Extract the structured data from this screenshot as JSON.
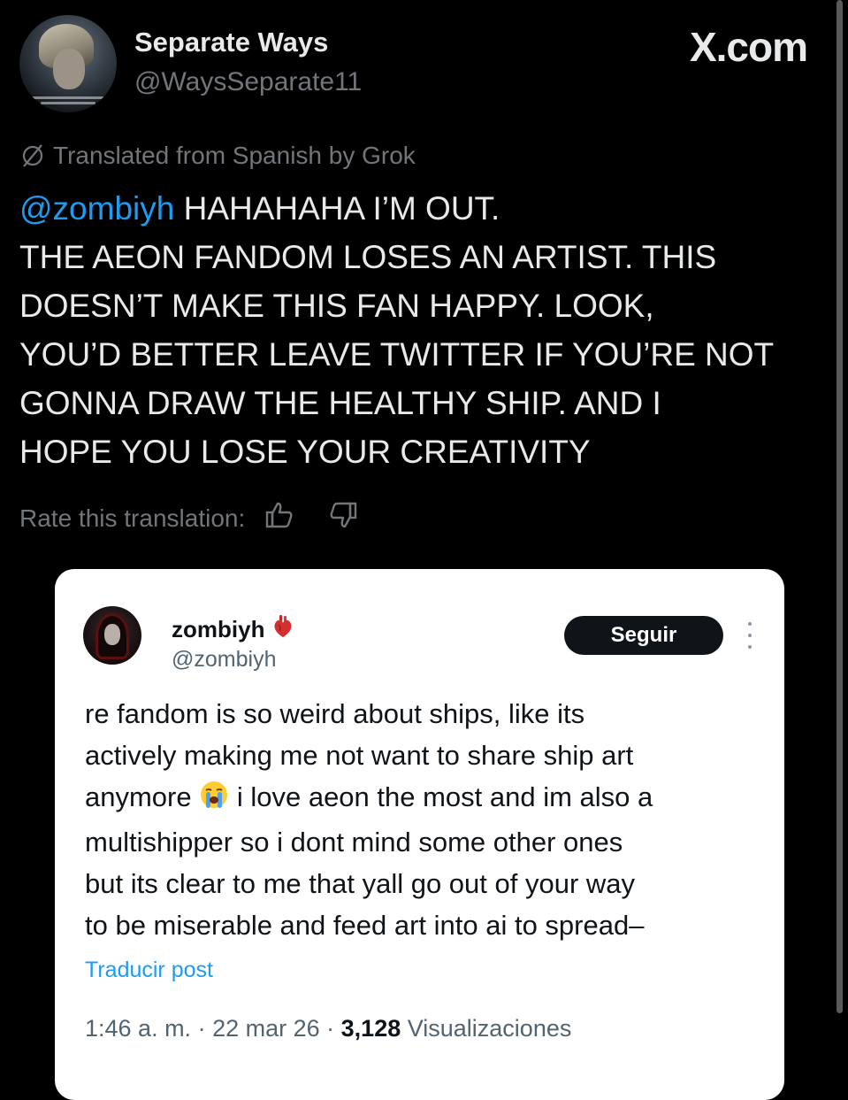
{
  "header": {
    "display_name": "Separate Ways",
    "handle": "@WaysSeparate11",
    "site_logo": "X.com",
    "avatar_icon": "profile-avatar"
  },
  "translation": {
    "notice": "Translated from Spanish by Grok",
    "icon": "translate-icon"
  },
  "tweet": {
    "mention": "@zombiyh",
    "body_first": " HAHAHAHA I’M OUT.",
    "body_rest": "THE AEON FANDOM LOSES AN ARTIST. THIS\nDOESN’T MAKE THIS FAN HAPPY. LOOK,\nYOU’D BETTER LEAVE TWITTER IF YOU’RE NOT\nGONNA DRAW THE HEALTHY SHIP. AND I\nHOPE YOU LOSE YOUR CREATIVITY"
  },
  "rating": {
    "label": "Rate this translation:",
    "thumbs_up_icon": "thumbs-up-icon",
    "thumbs_down_icon": "thumbs-down-icon"
  },
  "quoted": {
    "display_name": "zombiyh",
    "badge_icon": "anatomical-heart-emoji",
    "handle": "@zombiyh",
    "follow_label": "Seguir",
    "text_before_emoji": "re fandom is so weird about ships, like its\nactively making me not want to share ship art\nanymore ",
    "emoji": "loudly-crying-face-emoji",
    "text_after_emoji": " i love aeon the most and im also a\nmultishipper so i dont mind some other ones\nbut its clear to me that yall go out of your way\nto be miserable and feed art into ai to spread–",
    "translate_label": "Traducir post",
    "time": "1:46 a. m.",
    "sep1": " · ",
    "date": "22 mar 26",
    "sep2": " · ",
    "views_count": "3,128",
    "views_label": " Visualizaciones"
  },
  "colors": {
    "background": "#000000",
    "link": "#1d9bf0",
    "muted": "#71767b",
    "card": "#ffffff"
  }
}
